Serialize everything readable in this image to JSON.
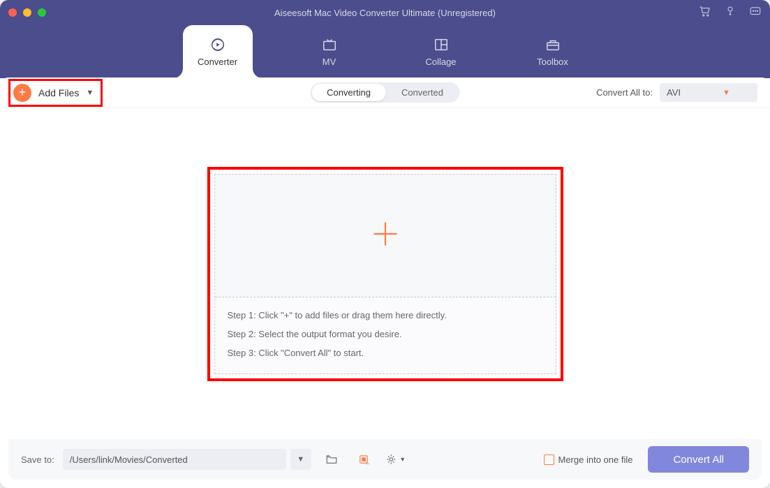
{
  "title": "Aiseesoft Mac Video Converter Ultimate (Unregistered)",
  "nav": {
    "converter": "Converter",
    "mv": "MV",
    "collage": "Collage",
    "toolbox": "Toolbox"
  },
  "addFiles": {
    "label": "Add Files"
  },
  "segments": {
    "converting": "Converting",
    "converted": "Converted"
  },
  "convertAllTo": {
    "label": "Convert All to:",
    "value": "AVI"
  },
  "steps": {
    "s1": "Step 1: Click \"+\" to add files or drag them here directly.",
    "s2": "Step 2: Select the output format you desire.",
    "s3": "Step 3: Click \"Convert All\" to start."
  },
  "bottom": {
    "saveTo": "Save to:",
    "path": "/Users/link/Movies/Converted",
    "merge": "Merge into one file",
    "convertAll": "Convert All"
  }
}
